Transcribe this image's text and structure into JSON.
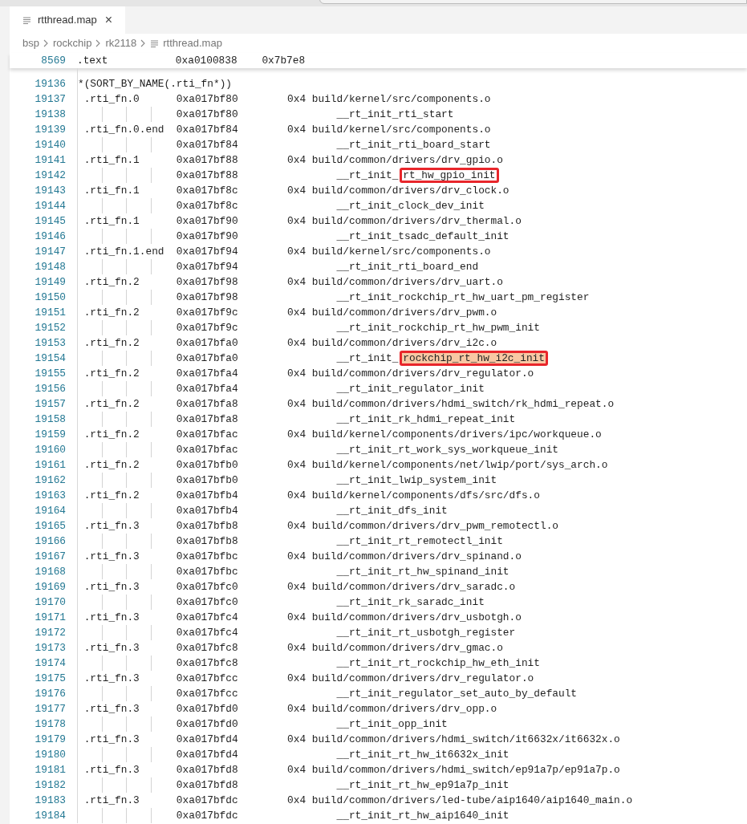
{
  "tabs": [
    {
      "label": "rtthread.map",
      "selected": true,
      "close": "×"
    }
  ],
  "breadcrumb": [
    "bsp",
    "rockchip",
    "rk2118",
    "rtthread.map"
  ],
  "sticky_line": {
    "number": "8569",
    "section": ".text",
    "address": "0xa0100838",
    "size": "0x7b7e8"
  },
  "lines": [
    {
      "kind": "text",
      "number": "19136",
      "text": "*(SORT_BY_NAME(.rti_fn*))"
    },
    {
      "kind": "entry",
      "number": "19137",
      "section": ".rti_fn.0",
      "address": "0xa017bf80",
      "size": "0x4",
      "object": "build/kernel/src/components.o"
    },
    {
      "kind": "symbol",
      "number": "19138",
      "address": "0xa017bf80",
      "symbol": "__rt_init_rti_start"
    },
    {
      "kind": "entry",
      "number": "19139",
      "section": ".rti_fn.0.end",
      "address": "0xa017bf84",
      "size": "0x4",
      "object": "build/kernel/src/components.o"
    },
    {
      "kind": "symbol",
      "number": "19140",
      "address": "0xa017bf84",
      "symbol": "__rt_init_rti_board_start"
    },
    {
      "kind": "entry",
      "number": "19141",
      "section": ".rti_fn.1",
      "address": "0xa017bf88",
      "size": "0x4",
      "object": "build/common/drivers/drv_gpio.o"
    },
    {
      "kind": "symbol",
      "number": "19142",
      "address": "0xa017bf88",
      "symbol": "__rt_init_",
      "mark": {
        "text": "rt_hw_gpio_init",
        "filled": false
      }
    },
    {
      "kind": "entry",
      "number": "19143",
      "section": ".rti_fn.1",
      "address": "0xa017bf8c",
      "size": "0x4",
      "object": "build/common/drivers/drv_clock.o"
    },
    {
      "kind": "symbol",
      "number": "19144",
      "address": "0xa017bf8c",
      "symbol": "__rt_init_clock_dev_init"
    },
    {
      "kind": "entry",
      "number": "19145",
      "section": ".rti_fn.1",
      "address": "0xa017bf90",
      "size": "0x4",
      "object": "build/common/drivers/drv_thermal.o"
    },
    {
      "kind": "symbol",
      "number": "19146",
      "address": "0xa017bf90",
      "symbol": "__rt_init_tsadc_default_init"
    },
    {
      "kind": "entry",
      "number": "19147",
      "section": ".rti_fn.1.end",
      "address": "0xa017bf94",
      "size": "0x4",
      "object": "build/kernel/src/components.o"
    },
    {
      "kind": "symbol",
      "number": "19148",
      "address": "0xa017bf94",
      "symbol": "__rt_init_rti_board_end"
    },
    {
      "kind": "entry",
      "number": "19149",
      "section": ".rti_fn.2",
      "address": "0xa017bf98",
      "size": "0x4",
      "object": "build/common/drivers/drv_uart.o"
    },
    {
      "kind": "symbol",
      "number": "19150",
      "address": "0xa017bf98",
      "symbol": "__rt_init_rockchip_rt_hw_uart_pm_register"
    },
    {
      "kind": "entry",
      "number": "19151",
      "section": ".rti_fn.2",
      "address": "0xa017bf9c",
      "size": "0x4",
      "object": "build/common/drivers/drv_pwm.o"
    },
    {
      "kind": "symbol",
      "number": "19152",
      "address": "0xa017bf9c",
      "symbol": "__rt_init_rockchip_rt_hw_pwm_init"
    },
    {
      "kind": "entry",
      "number": "19153",
      "section": ".rti_fn.2",
      "address": "0xa017bfa0",
      "size": "0x4",
      "object": "build/common/drivers/drv_i2c.o"
    },
    {
      "kind": "symbol",
      "number": "19154",
      "address": "0xa017bfa0",
      "symbol": "__rt_init_",
      "mark": {
        "text": "rockchip_rt_hw_i2c_init",
        "filled": true
      }
    },
    {
      "kind": "entry",
      "number": "19155",
      "section": ".rti_fn.2",
      "address": "0xa017bfa4",
      "size": "0x4",
      "object": "build/common/drivers/drv_regulator.o"
    },
    {
      "kind": "symbol",
      "number": "19156",
      "address": "0xa017bfa4",
      "symbol": "__rt_init_regulator_init"
    },
    {
      "kind": "entry",
      "number": "19157",
      "section": ".rti_fn.2",
      "address": "0xa017bfa8",
      "size": "0x4",
      "object": "build/common/drivers/hdmi_switch/rk_hdmi_repeat.o"
    },
    {
      "kind": "symbol",
      "number": "19158",
      "address": "0xa017bfa8",
      "symbol": "__rt_init_rk_hdmi_repeat_init"
    },
    {
      "kind": "entry",
      "number": "19159",
      "section": ".rti_fn.2",
      "address": "0xa017bfac",
      "size": "0x4",
      "object": "build/kernel/components/drivers/ipc/workqueue.o"
    },
    {
      "kind": "symbol",
      "number": "19160",
      "address": "0xa017bfac",
      "symbol": "__rt_init_rt_work_sys_workqueue_init"
    },
    {
      "kind": "entry",
      "number": "19161",
      "section": ".rti_fn.2",
      "address": "0xa017bfb0",
      "size": "0x4",
      "object": "build/kernel/components/net/lwip/port/sys_arch.o"
    },
    {
      "kind": "symbol",
      "number": "19162",
      "address": "0xa017bfb0",
      "symbol": "__rt_init_lwip_system_init"
    },
    {
      "kind": "entry",
      "number": "19163",
      "section": ".rti_fn.2",
      "address": "0xa017bfb4",
      "size": "0x4",
      "object": "build/kernel/components/dfs/src/dfs.o"
    },
    {
      "kind": "symbol",
      "number": "19164",
      "address": "0xa017bfb4",
      "symbol": "__rt_init_dfs_init"
    },
    {
      "kind": "entry",
      "number": "19165",
      "section": ".rti_fn.3",
      "address": "0xa017bfb8",
      "size": "0x4",
      "object": "build/common/drivers/drv_pwm_remotectl.o"
    },
    {
      "kind": "symbol",
      "number": "19166",
      "address": "0xa017bfb8",
      "symbol": "__rt_init_rt_remotectl_init"
    },
    {
      "kind": "entry",
      "number": "19167",
      "section": ".rti_fn.3",
      "address": "0xa017bfbc",
      "size": "0x4",
      "object": "build/common/drivers/drv_spinand.o"
    },
    {
      "kind": "symbol",
      "number": "19168",
      "address": "0xa017bfbc",
      "symbol": "__rt_init_rt_hw_spinand_init"
    },
    {
      "kind": "entry",
      "number": "19169",
      "section": ".rti_fn.3",
      "address": "0xa017bfc0",
      "size": "0x4",
      "object": "build/common/drivers/drv_saradc.o"
    },
    {
      "kind": "symbol",
      "number": "19170",
      "address": "0xa017bfc0",
      "symbol": "__rt_init_rk_saradc_init"
    },
    {
      "kind": "entry",
      "number": "19171",
      "section": ".rti_fn.3",
      "address": "0xa017bfc4",
      "size": "0x4",
      "object": "build/common/drivers/drv_usbotgh.o"
    },
    {
      "kind": "symbol",
      "number": "19172",
      "address": "0xa017bfc4",
      "symbol": "__rt_init_rt_usbotgh_register"
    },
    {
      "kind": "entry",
      "number": "19173",
      "section": ".rti_fn.3",
      "address": "0xa017bfc8",
      "size": "0x4",
      "object": "build/common/drivers/drv_gmac.o"
    },
    {
      "kind": "symbol",
      "number": "19174",
      "address": "0xa017bfc8",
      "symbol": "__rt_init_rt_rockchip_hw_eth_init"
    },
    {
      "kind": "entry",
      "number": "19175",
      "section": ".rti_fn.3",
      "address": "0xa017bfcc",
      "size": "0x4",
      "object": "build/common/drivers/drv_regulator.o"
    },
    {
      "kind": "symbol",
      "number": "19176",
      "address": "0xa017bfcc",
      "symbol": "__rt_init_regulator_set_auto_by_default"
    },
    {
      "kind": "entry",
      "number": "19177",
      "section": ".rti_fn.3",
      "address": "0xa017bfd0",
      "size": "0x4",
      "object": "build/common/drivers/drv_opp.o"
    },
    {
      "kind": "symbol",
      "number": "19178",
      "address": "0xa017bfd0",
      "symbol": "__rt_init_opp_init"
    },
    {
      "kind": "entry",
      "number": "19179",
      "section": ".rti_fn.3",
      "address": "0xa017bfd4",
      "size": "0x4",
      "object": "build/common/drivers/hdmi_switch/it6632x/it6632x.o"
    },
    {
      "kind": "symbol",
      "number": "19180",
      "address": "0xa017bfd4",
      "symbol": "__rt_init_rt_hw_it6632x_init"
    },
    {
      "kind": "entry",
      "number": "19181",
      "section": ".rti_fn.3",
      "address": "0xa017bfd8",
      "size": "0x4",
      "object": "build/common/drivers/hdmi_switch/ep91a7p/ep91a7p.o"
    },
    {
      "kind": "symbol",
      "number": "19182",
      "address": "0xa017bfd8",
      "symbol": "__rt_init_rt_hw_ep91a7p_init"
    },
    {
      "kind": "entry",
      "number": "19183",
      "section": ".rti_fn.3",
      "address": "0xa017bfdc",
      "size": "0x4",
      "object": "build/common/drivers/led-tube/aip1640/aip1640_main.o"
    },
    {
      "kind": "symbol",
      "number": "19184",
      "address": "0xa017bfdc",
      "symbol": "__rt_init_rt_hw_aip1640_init"
    }
  ]
}
